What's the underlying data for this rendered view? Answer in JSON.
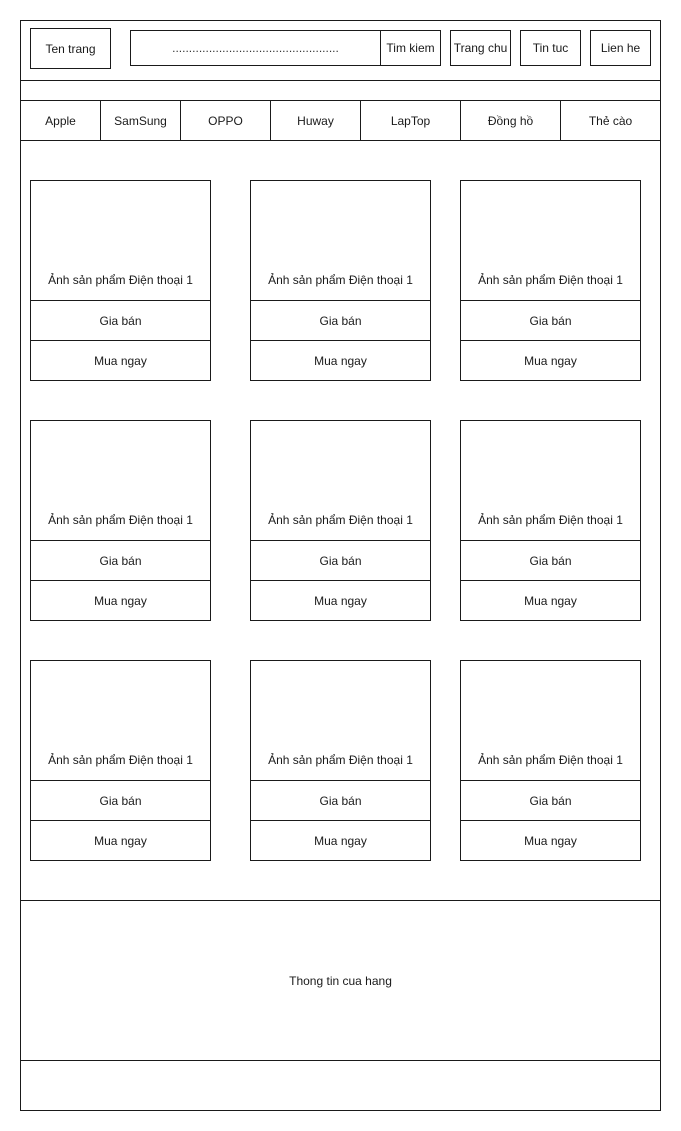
{
  "header": {
    "site_name": "Ten trang",
    "search_placeholder": "..................................................",
    "search_button": "Tim kiem",
    "nav": [
      "Trang chu",
      "Tin tuc",
      "Lien he"
    ]
  },
  "categories": [
    "Apple",
    "SamSung",
    "OPPO",
    "Huway",
    "LapTop",
    "Đồng hồ",
    "Thẻ cào"
  ],
  "products": [
    {
      "image_label": "Ảnh sản phẩm Điện thoại 1",
      "price_label": "Gia bán",
      "buy_label": "Mua ngay"
    },
    {
      "image_label": "Ảnh sản phẩm Điện thoại 1",
      "price_label": "Gia bán",
      "buy_label": "Mua ngay"
    },
    {
      "image_label": "Ảnh sản phẩm Điện thoại 1",
      "price_label": "Gia bán",
      "buy_label": "Mua ngay"
    },
    {
      "image_label": "Ảnh sản phẩm Điện thoại 1",
      "price_label": "Gia bán",
      "buy_label": "Mua ngay"
    },
    {
      "image_label": "Ảnh sản phẩm Điện thoại 1",
      "price_label": "Gia bán",
      "buy_label": "Mua ngay"
    },
    {
      "image_label": "Ảnh sản phẩm Điện thoại 1",
      "price_label": "Gia bán",
      "buy_label": "Mua ngay"
    },
    {
      "image_label": "Ảnh sản phẩm Điện thoại 1",
      "price_label": "Gia bán",
      "buy_label": "Mua ngay"
    },
    {
      "image_label": "Ảnh sản phẩm Điện thoại 1",
      "price_label": "Gia bán",
      "buy_label": "Mua ngay"
    },
    {
      "image_label": "Ảnh sản phẩm Điện thoại 1",
      "price_label": "Gia bán",
      "buy_label": "Mua ngay"
    }
  ],
  "footer": {
    "store_info": "Thong tin cua hang"
  }
}
